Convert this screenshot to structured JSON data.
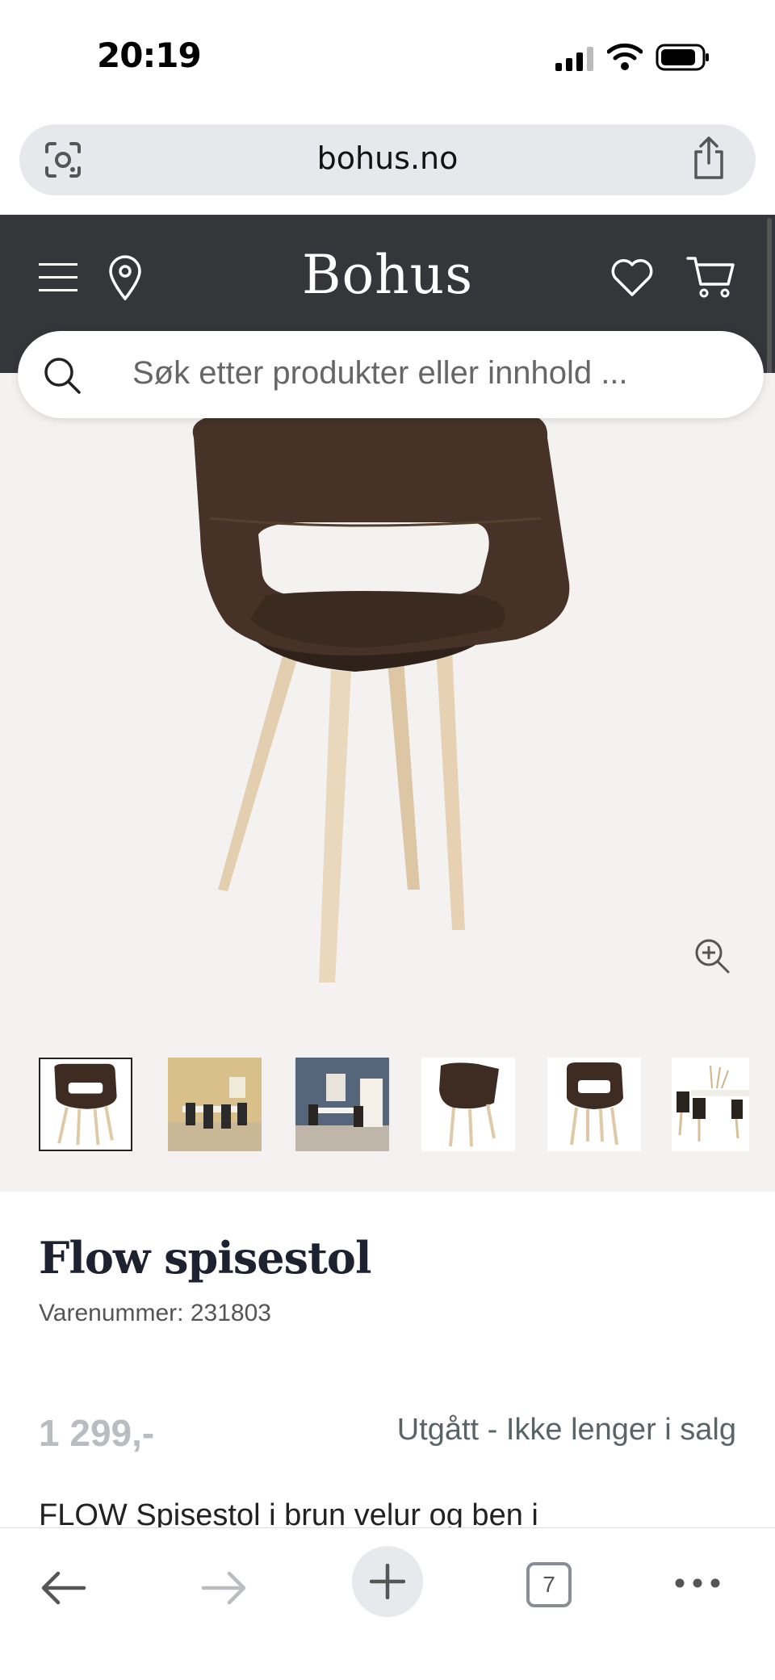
{
  "status_bar": {
    "time": "20:19"
  },
  "browser": {
    "url": "bohus.no",
    "tab_count": "7"
  },
  "header": {
    "brand": "Bohus",
    "search_placeholder": "Søk etter produkter eller innhold ..."
  },
  "gallery": {
    "thumbnail_count": 6,
    "active_index": 0
  },
  "product": {
    "title": "Flow spisestol",
    "sku_label": "Varenummer: 231803",
    "price": "1 299,-",
    "availability": "Utgått - Ikke lenger i salg",
    "description": "FLOW Spisestol i brun velur og ben i"
  },
  "colors": {
    "header_bg": "#35363a",
    "gallery_bg": "#f4f2f0",
    "price": "#b9bcc0",
    "availability": "#5a6366"
  }
}
